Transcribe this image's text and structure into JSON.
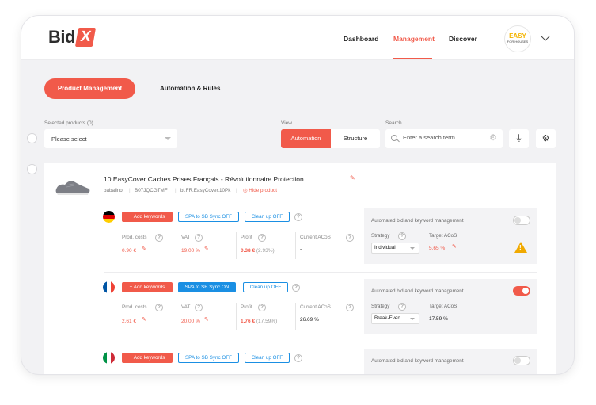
{
  "brand": {
    "name": "Bid",
    "mark": "X"
  },
  "nav": {
    "items": [
      "Dashboard",
      "Management",
      "Discover"
    ],
    "active": "Management"
  },
  "account": {
    "logo_line1": "EASY",
    "logo_line2": "FOR HOUSES"
  },
  "tabs": {
    "product_management": "Product Management",
    "automation_rules": "Automation & Rules"
  },
  "filters": {
    "selected_products_label": "Selected products (0)",
    "select_placeholder": "Please select",
    "view_label": "View",
    "view_automation": "Automation",
    "view_structure": "Structure",
    "search_label": "Search",
    "search_placeholder": "Enter a search term ..."
  },
  "product": {
    "title": "10 EasyCover Caches Prises Français - Révolutionnaire Protection...",
    "brand": "babalino",
    "asin": "B07JQCGTMF",
    "sku": "bl.FR.EasyCover.10Pk",
    "hide_label": "Hide product"
  },
  "labels": {
    "add_keywords": "+ Add keywords",
    "clean_up": "Clean up OFF",
    "prod_costs": "Prod. costs",
    "vat": "VAT",
    "profit": "Profit",
    "current_acos": "Current ACoS",
    "automated": "Automated bid and keyword management",
    "strategy": "Strategy",
    "target_acos": "Target ACoS",
    "help": "?"
  },
  "markets": [
    {
      "country": "DE",
      "flag": [
        "#000000",
        "#dd0000",
        "#ffce00"
      ],
      "flag_dir": "horizontal",
      "spa": "SPA to SB Sync OFF",
      "spa_on": false,
      "prod_costs": "0.90 €",
      "vat": "19.00 %",
      "profit": "0.38 €",
      "profit_pct": "(2.93%)",
      "current_acos": "-",
      "strategy": "Individual",
      "target_acos": "5.65 %",
      "automated_on": false,
      "warning": true
    },
    {
      "country": "FR",
      "flag": [
        "#0055a4",
        "#ffffff",
        "#ef4135"
      ],
      "flag_dir": "vertical",
      "spa": "SPA to SB Sync ON",
      "spa_on": true,
      "prod_costs": "2.61 €",
      "vat": "20.00 %",
      "profit": "1.76 €",
      "profit_pct": "(17.59%)",
      "current_acos": "26.69 %",
      "strategy": "Break-Even",
      "target_acos": "17.59 %",
      "automated_on": true,
      "warning": false
    },
    {
      "country": "IT",
      "flag": [
        "#009246",
        "#ffffff",
        "#ce2b37"
      ],
      "flag_dir": "vertical",
      "spa": "SPA to SB Sync OFF",
      "spa_on": false,
      "automated_on": false
    }
  ],
  "colors": {
    "accent": "#f15a4a",
    "blue": "#1a8fe3",
    "warning": "#f0a900"
  }
}
